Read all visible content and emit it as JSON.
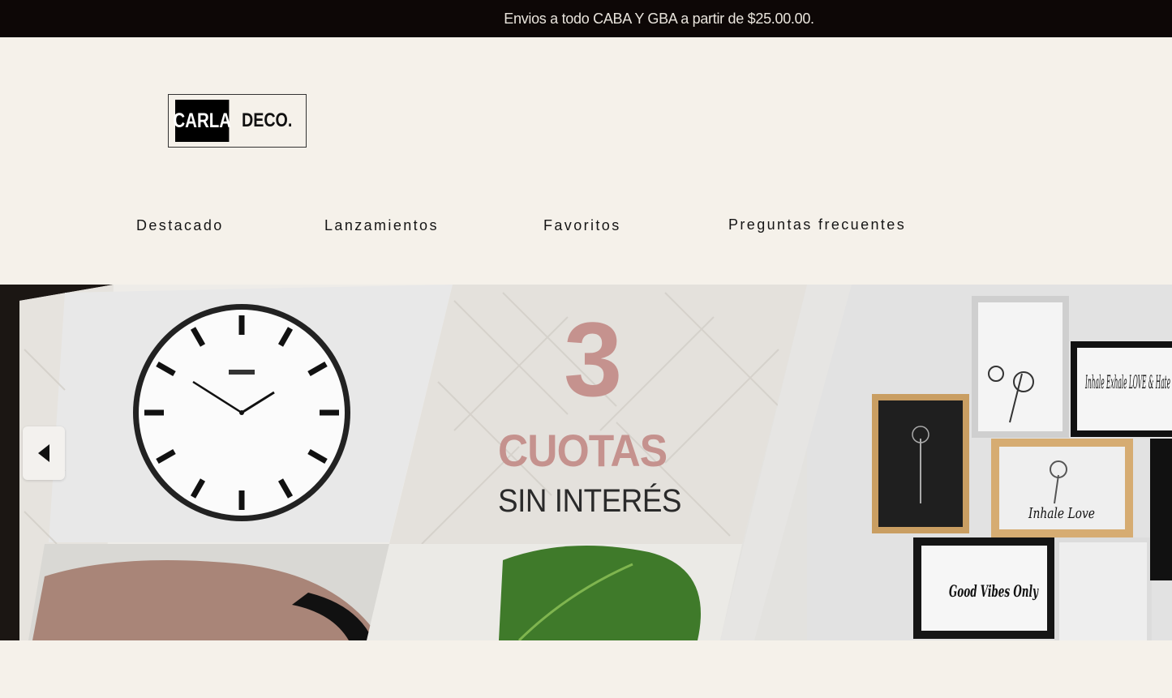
{
  "announcement": {
    "text": "Envios a todo CABA Y GBA a partir de $25.00.00."
  },
  "logo": {
    "left_text": "CARLA",
    "right_text": "DECO."
  },
  "nav": {
    "items": [
      {
        "label": "Destacado"
      },
      {
        "label": "Lanzamientos"
      },
      {
        "label": "Favoritos"
      },
      {
        "label": "Preguntas frecuentes"
      }
    ]
  },
  "hero": {
    "big_number": "3",
    "title": "CUOTAS",
    "subtitle": "SIN INTERÉS",
    "frame_text_1": "Inhale Exhale LOVE & Hate",
    "frame_text_2": "Inhale Love",
    "frame_text_3": "Good Vibes Only",
    "prev_icon": "chevron-left-icon"
  },
  "colors": {
    "topbar_bg": "#0d0706",
    "page_bg": "#f5f1ea",
    "promo_pink": "#c5928e"
  }
}
